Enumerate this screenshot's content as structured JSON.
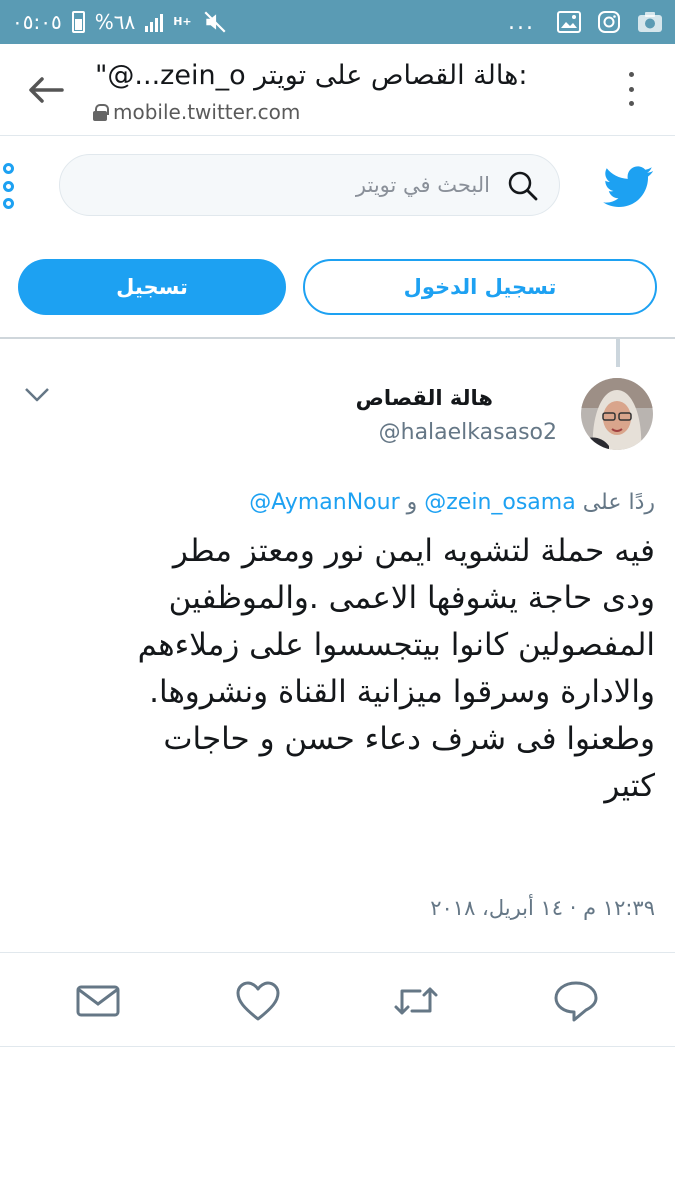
{
  "status_bar": {
    "time": "٠٥:٠٥",
    "battery": "%٦٨",
    "network": "H+",
    "overflow": "..."
  },
  "browser": {
    "title": "\"@...zein_o هالة القصاص على تويتر: ",
    "url": "mobile.twitter.com"
  },
  "twitter": {
    "search_placeholder": "البحث في تويتر",
    "login_label": "تسجيل الدخول",
    "signup_label": "تسجيل"
  },
  "tweet": {
    "author_name": "هالة القصاص",
    "author_handle": "@halaelkasaso2",
    "reply_prefix": "ردًا على",
    "reply_mention_1": "@zein_osama",
    "reply_and": "و",
    "reply_mention_2": "@AymanNour",
    "body": "فيه حملة لتشويه ايمن نور ومعتز مطر\nودى حاجة يشوفها الاعمى  .والموظفين\nالمفصولين كانوا بيتجسسوا على زملاءهم\nوالادارة وسرقوا ميزانية القناة ونشروها.\nوطعنوا فى شرف دعاء حسن و حاجات\nكتير",
    "timestamp": "١٢:٣٩ م · ١٤ أبريل، ٢٠١٨"
  },
  "colors": {
    "accent": "#1da1f2",
    "status_bar": "#5a9bb4",
    "muted": "#657786"
  },
  "icons": [
    "back-arrow-icon",
    "lock-icon",
    "more-options-icon",
    "twitter-bird-icon",
    "search-icon",
    "chevron-down-icon",
    "message-icon",
    "like-icon",
    "retweet-icon",
    "reply-icon"
  ]
}
